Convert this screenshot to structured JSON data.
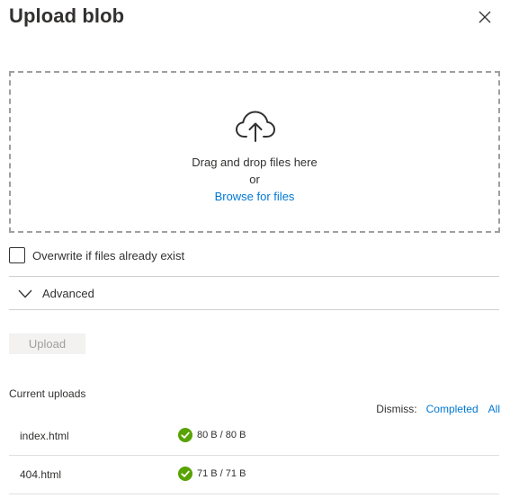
{
  "panel": {
    "title": "Upload blob",
    "close_icon": "close-icon"
  },
  "dropzone": {
    "icon": "cloud-upload-icon",
    "drag_text": "Drag and drop files here",
    "or_text": "or",
    "browse_label": "Browse for files"
  },
  "options": {
    "overwrite_label": "Overwrite if files already exist",
    "overwrite_checked": false,
    "advanced_label": "Advanced",
    "advanced_icon": "chevron-down-icon"
  },
  "actions": {
    "upload_label": "Upload"
  },
  "uploads": {
    "heading": "Current uploads",
    "dismiss_label": "Dismiss:",
    "dismiss_completed": "Completed",
    "dismiss_all": "All",
    "items": [
      {
        "name": "index.html",
        "status_icon": "check-circle-icon",
        "progress": "80 B / 80 B"
      },
      {
        "name": "404.html",
        "status_icon": "check-circle-icon",
        "progress": "71 B / 71 B"
      }
    ]
  },
  "colors": {
    "accent": "#0078d4",
    "success": "#57a300",
    "text": "#323130",
    "disabled_bg": "#f3f2f1",
    "disabled_text": "#a19f9d"
  }
}
